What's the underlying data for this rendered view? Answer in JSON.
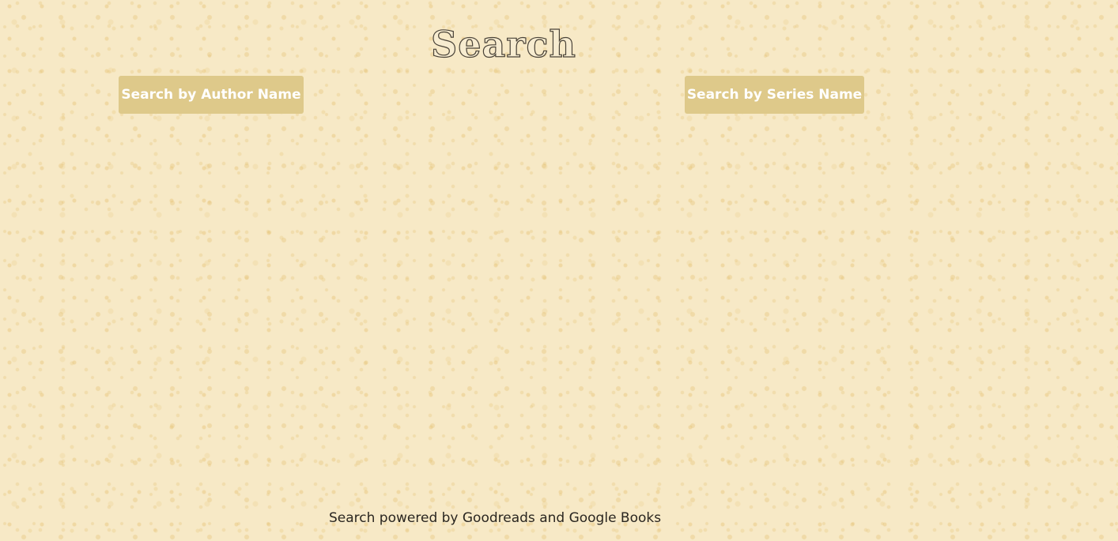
{
  "page": {
    "title": "Search"
  },
  "buttons": {
    "author": "Search by Author Name",
    "series": "Search by Series Name"
  },
  "footer": {
    "text": "Search powered by Goodreads and Google Books"
  },
  "colors": {
    "background": "#f7e9c6",
    "button_background": "#dec98a",
    "button_text": "#ffffff",
    "footer_text": "#2a2620",
    "title_outline": "#4a4338"
  }
}
